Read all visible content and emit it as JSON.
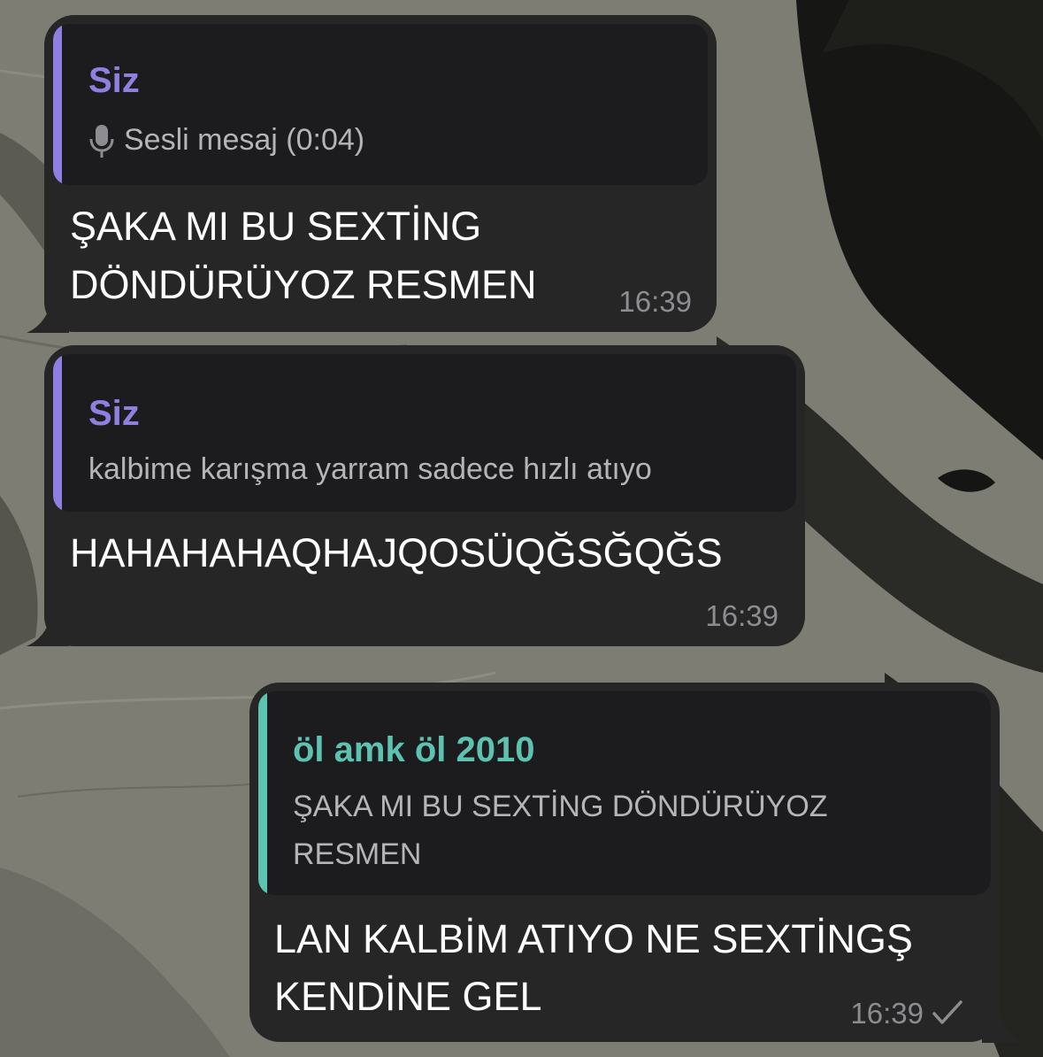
{
  "colors": {
    "incoming_bubble": "#262626",
    "quote_background": "#1c1c1e",
    "reply_self_accent": "#8e7fe0",
    "reply_other_accent": "#5ec2b0",
    "message_text": "#ffffff",
    "quoted_text": "#b5b5b8",
    "timestamp": "#8d8d91"
  },
  "messages": [
    {
      "direction": "incoming",
      "reply": {
        "author": "Siz",
        "icon": "microphone-icon",
        "text": "Sesli mesaj (0:04)"
      },
      "lines": [
        "ŞAKA MI BU SEXTİNG",
        "DÖNDÜRÜYOZ RESMEN"
      ],
      "time": "16:39"
    },
    {
      "direction": "incoming",
      "reply": {
        "author": "Siz",
        "text": "kalbime karışma yarram sadece hızlı atıyo"
      },
      "lines": [
        "HAHAHAHAQHAJQOSÜQĞSĞQĞS"
      ],
      "time": "16:39"
    },
    {
      "direction": "outgoing",
      "reply": {
        "author": "öl amk öl 2010",
        "lines": [
          "ŞAKA MI BU SEXTİNG DÖNDÜRÜYOZ",
          "RESMEN"
        ]
      },
      "lines": [
        "LAN KALBİM ATIYO NE SEXTİNGŞ",
        "KENDİNE GEL"
      ],
      "time": "16:39",
      "status_icon": "checkmark-icon"
    }
  ]
}
